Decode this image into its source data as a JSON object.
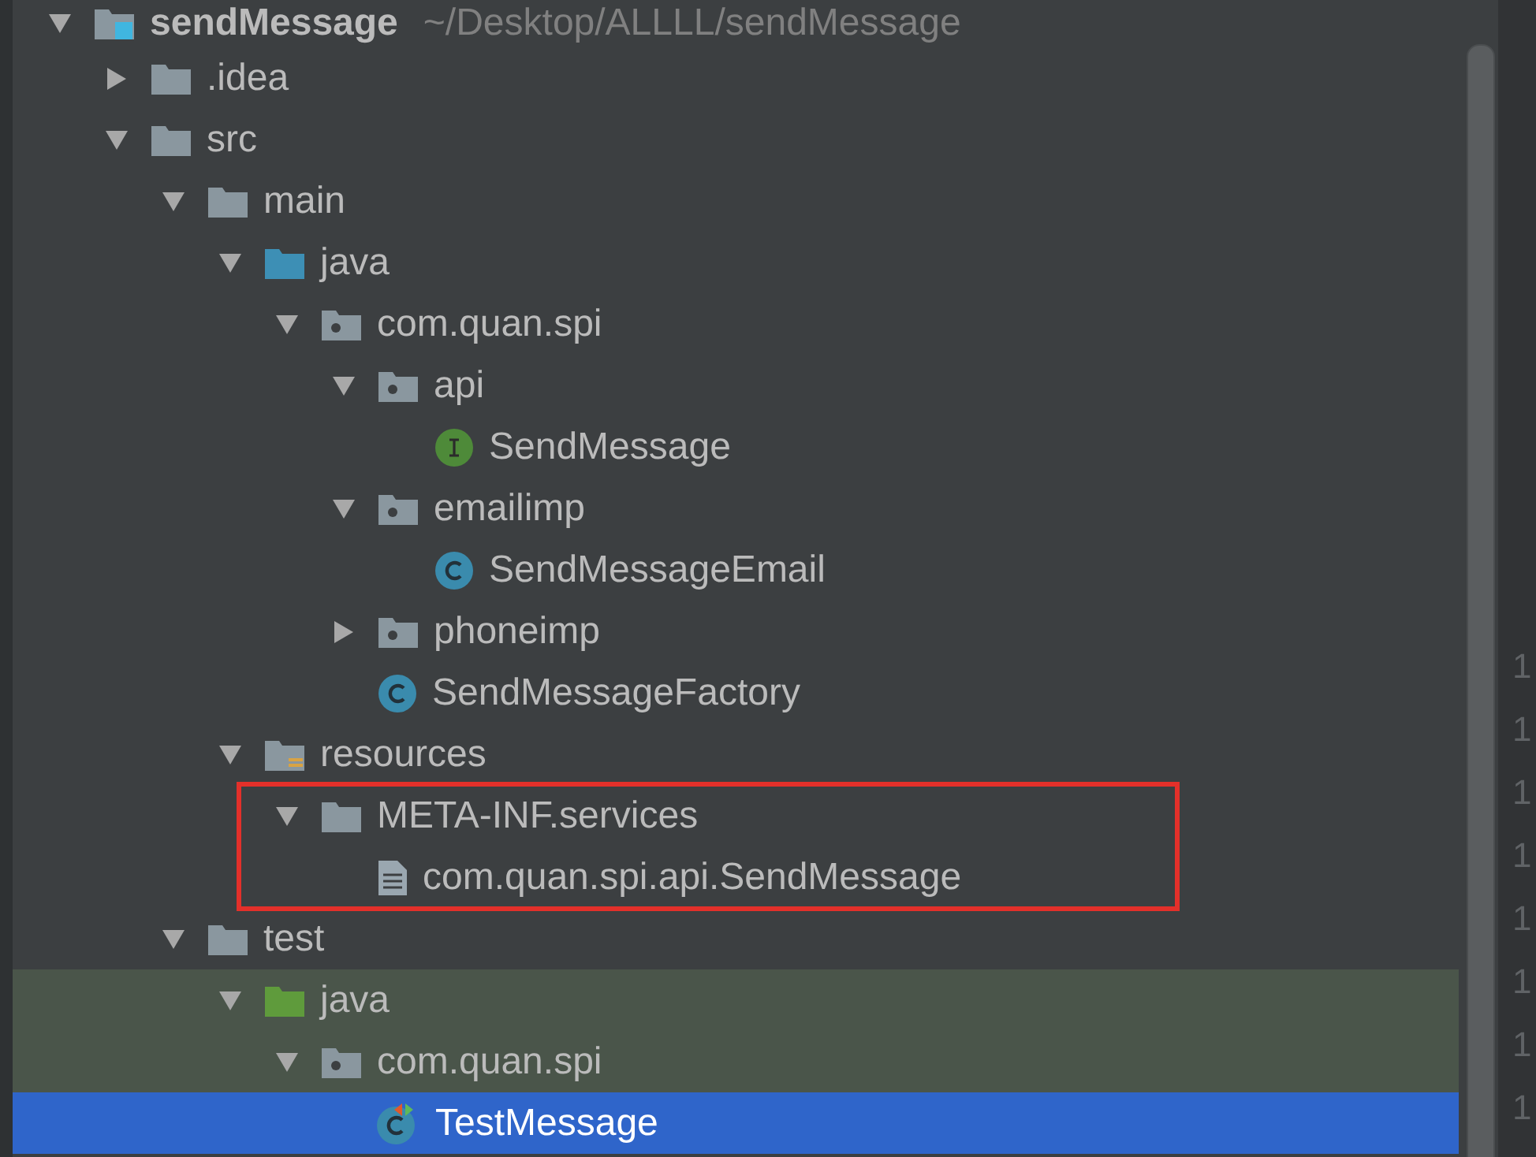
{
  "project_tree": {
    "root": {
      "kind": "module",
      "name": "sendMessage",
      "path": "~/Desktop/ALLLL/sendMessage",
      "expanded": true,
      "selected": false,
      "children": [
        {
          "kind": "folder",
          "name": ".idea",
          "expanded": false,
          "selected": false
        },
        {
          "kind": "folder",
          "name": "src",
          "expanded": true,
          "selected": false,
          "children": [
            {
              "kind": "folder",
              "name": "main",
              "expanded": true,
              "selected": false,
              "children": [
                {
                  "kind": "source-root",
                  "name": "java",
                  "expanded": true,
                  "selected": false,
                  "children": [
                    {
                      "kind": "package",
                      "name": "com.quan.spi",
                      "expanded": true,
                      "selected": false,
                      "children": [
                        {
                          "kind": "package",
                          "name": "api",
                          "expanded": true,
                          "selected": false,
                          "children": [
                            {
                              "kind": "interface",
                              "name": "SendMessage",
                              "selected": false
                            }
                          ]
                        },
                        {
                          "kind": "package",
                          "name": "emailimp",
                          "expanded": true,
                          "selected": false,
                          "children": [
                            {
                              "kind": "class",
                              "name": "SendMessageEmail",
                              "selected": false
                            }
                          ]
                        },
                        {
                          "kind": "package",
                          "name": "phoneimp",
                          "expanded": false,
                          "selected": false
                        },
                        {
                          "kind": "class",
                          "name": "SendMessageFactory",
                          "selected": false
                        }
                      ]
                    }
                  ]
                },
                {
                  "kind": "resources-root",
                  "name": "resources",
                  "expanded": true,
                  "selected": false,
                  "children": [
                    {
                      "kind": "folder",
                      "name": "META-INF.services",
                      "expanded": true,
                      "selected": false,
                      "boxed": true,
                      "children": [
                        {
                          "kind": "file",
                          "name": "com.quan.spi.api.SendMessage",
                          "selected": false
                        }
                      ]
                    }
                  ]
                }
              ]
            },
            {
              "kind": "folder",
              "name": "test",
              "expanded": true,
              "selected": false,
              "children": [
                {
                  "kind": "test-root",
                  "name": "java",
                  "expanded": true,
                  "selected": false,
                  "scoped": true,
                  "children": [
                    {
                      "kind": "package",
                      "name": "com.quan.spi",
                      "expanded": true,
                      "selected": false,
                      "scoped": true,
                      "children": [
                        {
                          "kind": "test-class",
                          "name": "TestMessage",
                          "selected": true
                        }
                      ]
                    }
                  ]
                }
              ]
            }
          ]
        }
      ]
    }
  },
  "gutter": {
    "line_numbers": [
      "1",
      "1",
      "1",
      "1",
      "1",
      "1",
      "1",
      "1"
    ]
  }
}
